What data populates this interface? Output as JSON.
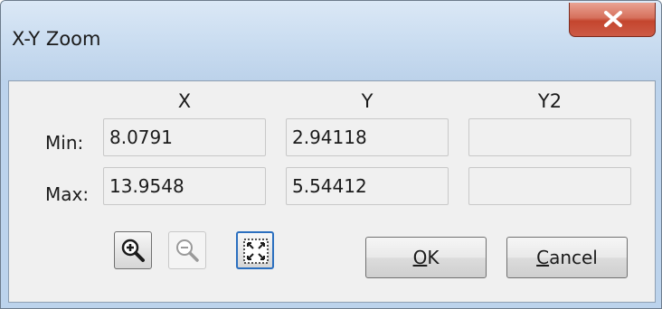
{
  "window": {
    "title": "X-Y Zoom",
    "close_icon": "close-icon"
  },
  "columns": {
    "x": "X",
    "y": "Y",
    "y2": "Y2"
  },
  "rows": {
    "min": {
      "label": "Min:",
      "x": "8.0791",
      "y": "2.94118",
      "y2": ""
    },
    "max": {
      "label": "Max:",
      "x": "13.9548",
      "y": "5.54412",
      "y2": ""
    }
  },
  "tools": {
    "zoom_in_icon": "zoom-in-icon",
    "zoom_out_icon": "zoom-out-icon",
    "zoom_fit_icon": "zoom-fit-icon"
  },
  "buttons": {
    "ok": {
      "mnemonic": "O",
      "rest": "K"
    },
    "cancel": {
      "mnemonic": "C",
      "rest": "ancel"
    }
  }
}
